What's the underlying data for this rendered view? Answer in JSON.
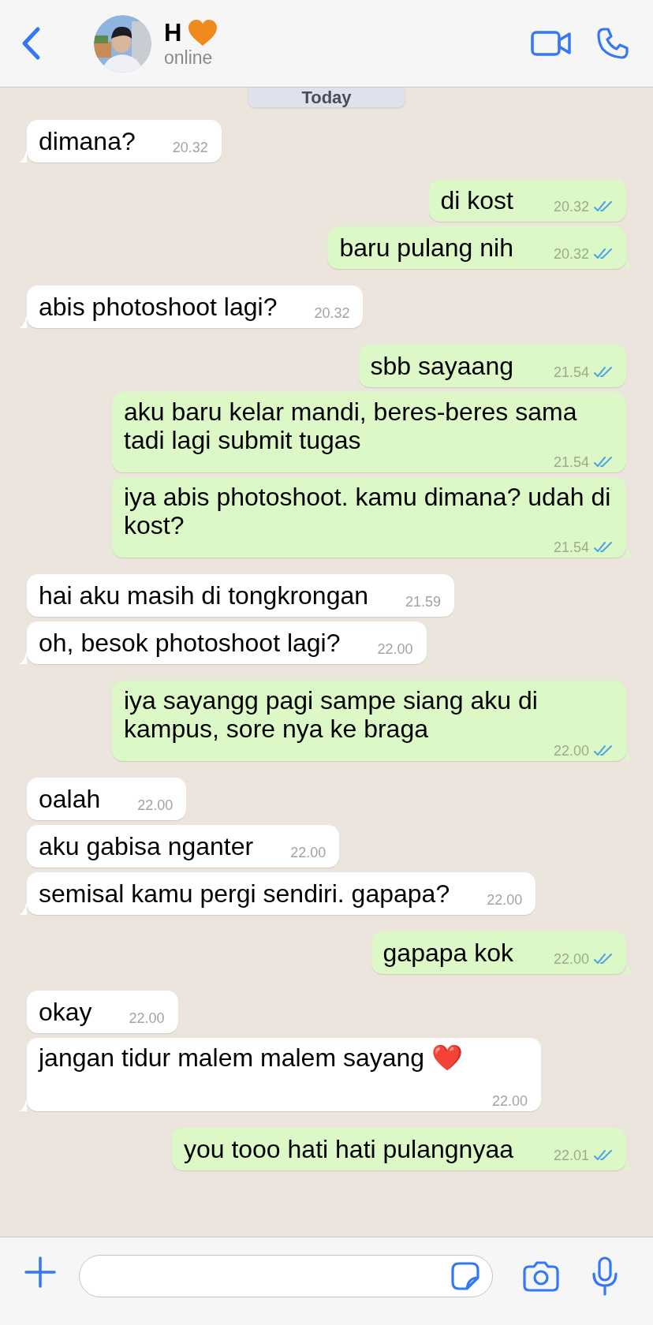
{
  "header": {
    "name": "H",
    "status": "online"
  },
  "date_badge": "Today",
  "messages": [
    {
      "kind": "incoming",
      "text": "dimana?",
      "time": "20.32"
    },
    {
      "kind": "outgoing",
      "text": "di kost",
      "time": "20.32",
      "read": true
    },
    {
      "kind": "outgoing",
      "text": "baru pulang nih",
      "time": "20.32",
      "read": true
    },
    {
      "kind": "incoming",
      "text": "abis photoshoot lagi?",
      "time": "20.32"
    },
    {
      "kind": "outgoing",
      "text": "sbb sayaang",
      "time": "21.54",
      "read": true
    },
    {
      "kind": "outgoing",
      "text": "aku baru kelar mandi, beres-beres sama tadi lagi submit tugas",
      "time": "21.54",
      "read": true
    },
    {
      "kind": "outgoing",
      "text": "iya abis photoshoot. kamu dimana? udah di kost?",
      "time": "21.54",
      "read": true
    },
    {
      "kind": "incoming",
      "text": "hai aku masih di tongkrongan",
      "time": "21.59"
    },
    {
      "kind": "incoming",
      "text": "oh, besok photoshoot lagi?",
      "time": "22.00"
    },
    {
      "kind": "outgoing",
      "text": "iya sayangg pagi sampe siang aku di kampus, sore nya ke braga",
      "time": "22.00",
      "read": true
    },
    {
      "kind": "incoming",
      "text": "oalah",
      "time": "22.00"
    },
    {
      "kind": "incoming",
      "text": "aku gabisa nganter",
      "time": "22.00"
    },
    {
      "kind": "incoming",
      "text": "semisal kamu pergi sendiri. gapapa?",
      "time": "22.00"
    },
    {
      "kind": "outgoing",
      "text": "gapapa kok",
      "time": "22.00",
      "read": true
    },
    {
      "kind": "incoming",
      "text": "okay",
      "time": "22.00"
    },
    {
      "kind": "incoming",
      "text": "jangan tidur malem malem sayang ❤️",
      "time": "22.00"
    },
    {
      "kind": "outgoing",
      "text": "you tooo hati hati pulangnyaa",
      "time": "22.01",
      "read": true
    }
  ]
}
